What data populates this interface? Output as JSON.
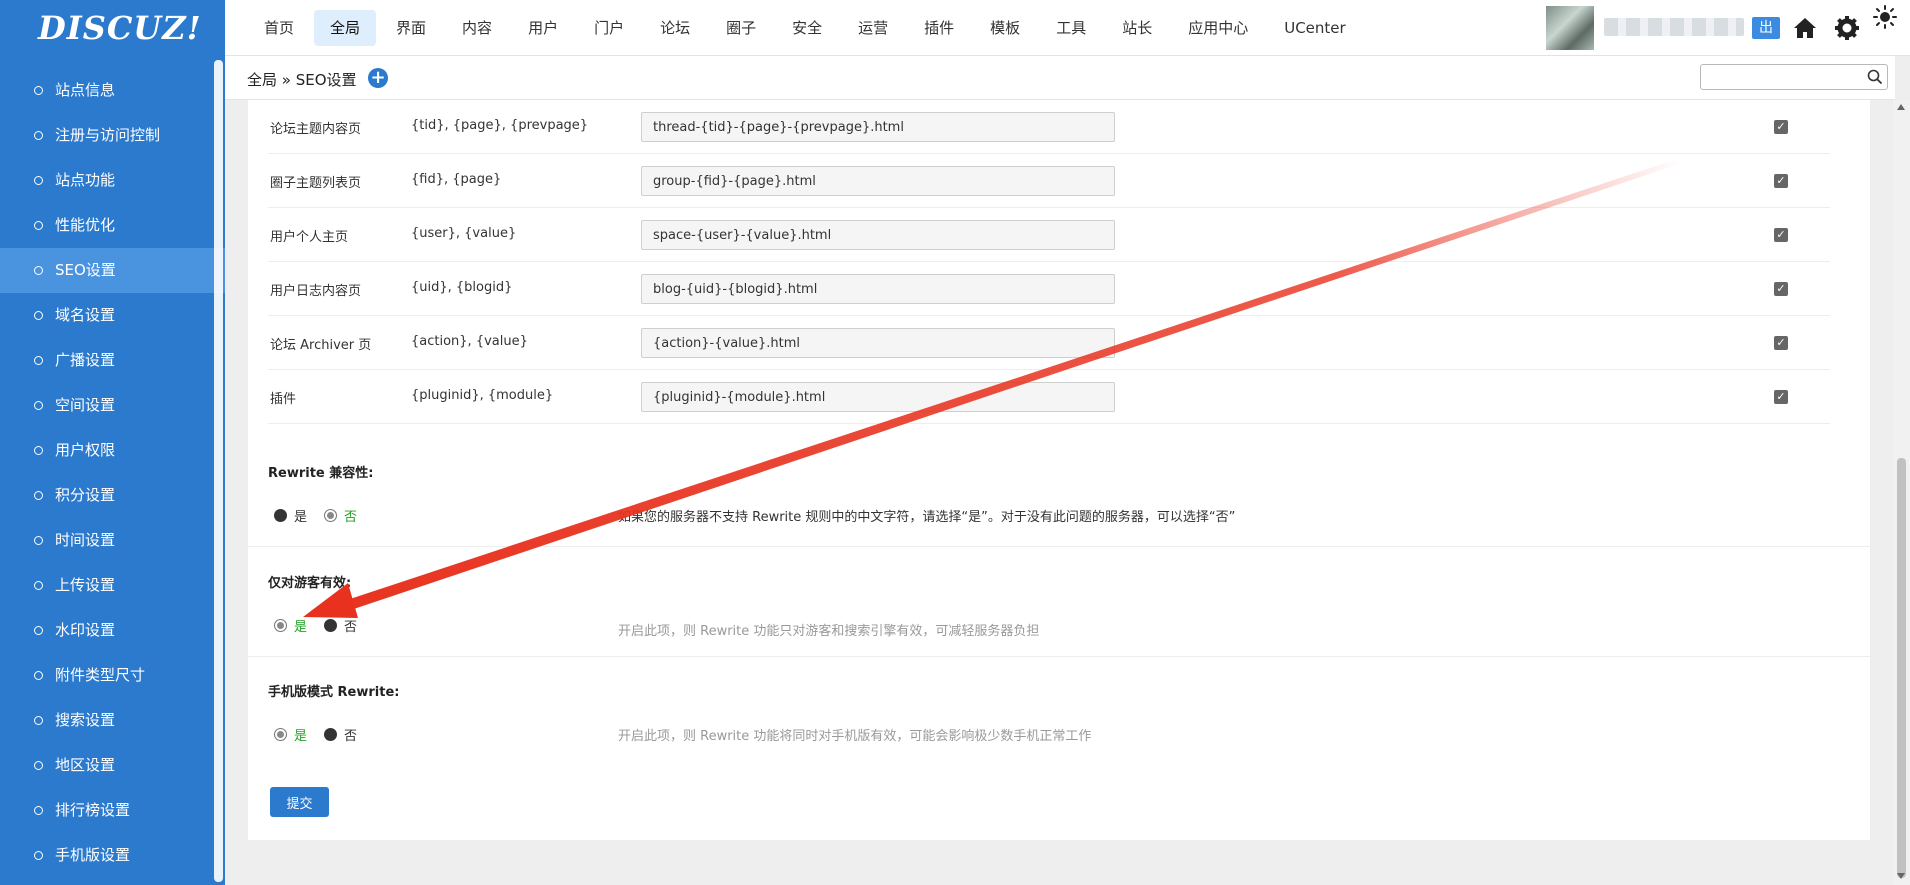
{
  "logo": "DISCUZ!",
  "topnav": [
    "首页",
    "全局",
    "界面",
    "内容",
    "用户",
    "门户",
    "论坛",
    "圈子",
    "安全",
    "运营",
    "插件",
    "模板",
    "工具",
    "站长",
    "应用中心",
    "UCenter"
  ],
  "topnav_active": "全局",
  "header": {
    "logout": "出"
  },
  "sidebar": [
    "站点信息",
    "注册与访问控制",
    "站点功能",
    "性能优化",
    "SEO设置",
    "域名设置",
    "广播设置",
    "空间设置",
    "用户权限",
    "积分设置",
    "时间设置",
    "上传设置",
    "水印设置",
    "附件类型尺寸",
    "搜索设置",
    "地区设置",
    "排行榜设置",
    "手机版设置"
  ],
  "sidebar_active": "SEO设置",
  "breadcrumb": {
    "text": "全局 » SEO设置",
    "plus": "+"
  },
  "search": {
    "value": ""
  },
  "rules": [
    {
      "name": "论坛主题内容页",
      "vars": "{tid}, {page}, {prevpage}",
      "value": "thread-{tid}-{page}-{prevpage}.html",
      "checked": true
    },
    {
      "name": "圈子主题列表页",
      "vars": "{fid}, {page}",
      "value": "group-{fid}-{page}.html",
      "checked": true
    },
    {
      "name": "用户个人主页",
      "vars": "{user}, {value}",
      "value": "space-{user}-{value}.html",
      "checked": true
    },
    {
      "name": "用户日志内容页",
      "vars": "{uid}, {blogid}",
      "value": "blog-{uid}-{blogid}.html",
      "checked": true
    },
    {
      "name": "论坛 Archiver 页",
      "vars": "{action}, {value}",
      "value": "{action}-{value}.html",
      "checked": true
    },
    {
      "name": "插件",
      "vars": "{pluginid}, {module}",
      "value": "{pluginid}-{module}.html",
      "checked": true
    }
  ],
  "settings": [
    {
      "title": "Rewrite 兼容性:",
      "yes": "是",
      "no": "否",
      "selected": "no",
      "desc": "如果您的服务器不支持 Rewrite 规则中的中文字符，请选择“是”。对于没有此问题的服务器，可以选择“否”",
      "desc_gray": false
    },
    {
      "title": "仅对游客有效:",
      "yes": "是",
      "no": "否",
      "selected": "yes",
      "desc": "开启此项，则 Rewrite 功能只对游客和搜索引擎有效，可减轻服务器负担",
      "desc_gray": true
    },
    {
      "title": "手机版模式 Rewrite:",
      "yes": "是",
      "no": "否",
      "selected": "yes",
      "desc": "开启此项，则 Rewrite 功能将同时对手机版有效，可能会影响极少数手机正常工作",
      "desc_gray": true
    }
  ],
  "submit": "提交",
  "colors": {
    "brand": "#2b7acd",
    "annotation_arrow": "#e8321f",
    "selected_label": "#21a321"
  }
}
